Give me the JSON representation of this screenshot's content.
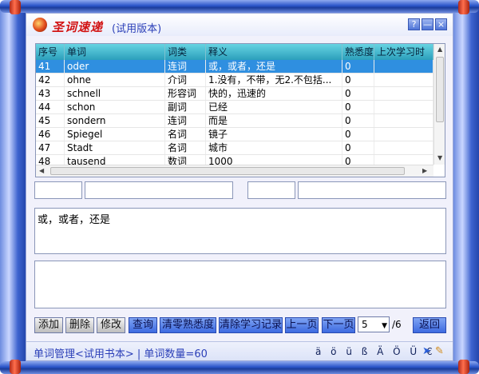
{
  "titlebar": {
    "brand": "圣词速递",
    "edition": "(试用版本)",
    "btn_help": "?",
    "btn_min": "—",
    "btn_close": "×"
  },
  "table": {
    "columns": [
      "序号",
      "单词",
      "词类",
      "释义",
      "熟悉度",
      "上次学习时"
    ],
    "rows": [
      {
        "id": "41",
        "word": "oder",
        "pos": "连词",
        "meaning": "或，或者，还是",
        "fam": "0",
        "last": "",
        "selected": true
      },
      {
        "id": "42",
        "word": "ohne",
        "pos": "介词",
        "meaning": "1.没有，不带，无2.不包括...",
        "fam": "0",
        "last": ""
      },
      {
        "id": "43",
        "word": "schnell",
        "pos": "形容词",
        "meaning": "快的，迅速的",
        "fam": "0",
        "last": ""
      },
      {
        "id": "44",
        "word": "schon",
        "pos": "副词",
        "meaning": "已经",
        "fam": "0",
        "last": ""
      },
      {
        "id": "45",
        "word": "sondern",
        "pos": "连词",
        "meaning": "而是",
        "fam": "0",
        "last": ""
      },
      {
        "id": "46",
        "word": "Spiegel",
        "pos": "名词",
        "meaning": "镜子",
        "fam": "0",
        "last": ""
      },
      {
        "id": "47",
        "word": "Stadt",
        "pos": "名词",
        "meaning": "城市",
        "fam": "0",
        "last": ""
      },
      {
        "id": "48",
        "word": "tausend",
        "pos": "数词",
        "meaning": "1000",
        "fam": "0",
        "last": ""
      }
    ]
  },
  "detail": {
    "meaning_text": "或，或者，还是"
  },
  "buttons": {
    "add": "添加",
    "delete": "删除",
    "edit": "修改",
    "query": "查询",
    "clear_familiarity": "清零熟悉度",
    "clear_history": "清除学习记录",
    "prev_page": "上一页",
    "next_page": "下一页",
    "back": "返回"
  },
  "pager": {
    "current": "5",
    "total": "/6"
  },
  "status": {
    "text": "单词管理<试用书本>  |  单词数量=60",
    "umlauts": "ä ö ü ß Ä Ö Ü €"
  }
}
